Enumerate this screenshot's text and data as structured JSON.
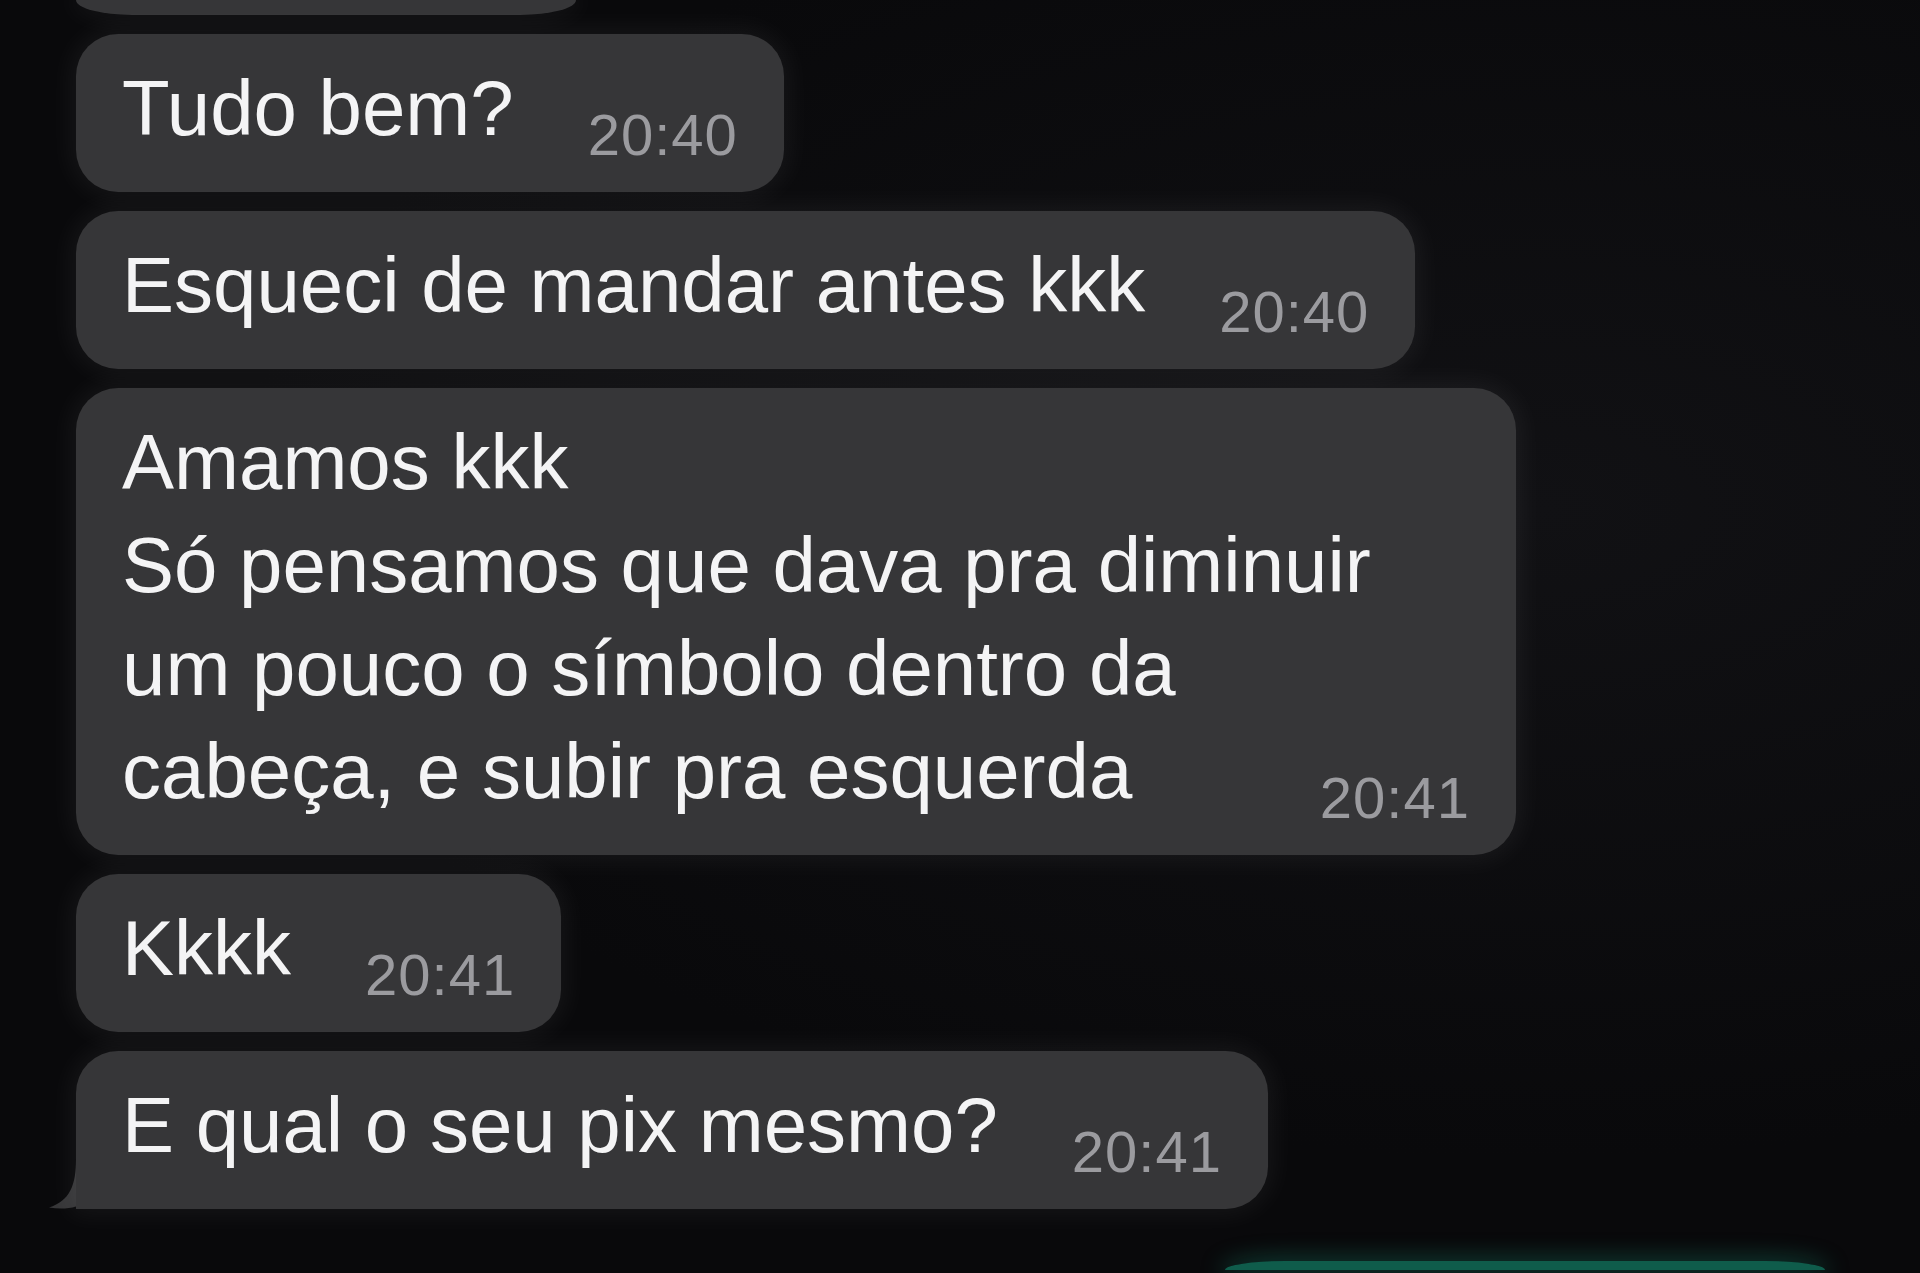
{
  "chat": {
    "messages": [
      {
        "kind": "cut-off",
        "outgoing": false,
        "tail": false
      },
      {
        "kind": "text",
        "outgoing": false,
        "text": "Tudo bem?",
        "time": "20:40",
        "tail": false
      },
      {
        "kind": "text",
        "outgoing": false,
        "text": "Esqueci de mandar antes kkk",
        "time": "20:40",
        "tail": false
      },
      {
        "kind": "text",
        "outgoing": false,
        "text": "Amamos kkk\nSó pensamos que dava pra diminuir um pouco o símbolo dentro da cabeça, e subir pra esquerda",
        "time": "20:41",
        "tail": false
      },
      {
        "kind": "text",
        "outgoing": false,
        "text": "Kkkk",
        "time": "20:41",
        "tail": false
      },
      {
        "kind": "text",
        "outgoing": false,
        "text": "E qual o seu pix mesmo?",
        "time": "20:41",
        "tail": true
      },
      {
        "kind": "cut-off",
        "outgoing": true,
        "tail": false
      }
    ]
  }
}
